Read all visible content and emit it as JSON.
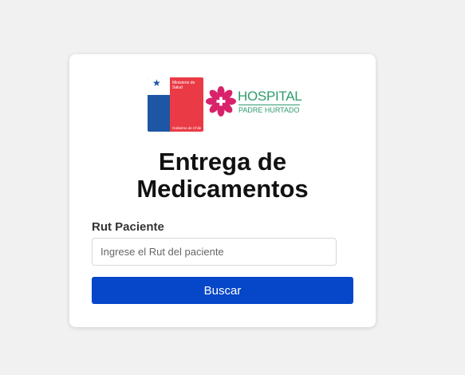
{
  "logos": {
    "ministry_line1": "Ministerio de",
    "ministry_line2": "Salud",
    "government": "Gobierno de Chile",
    "hospital_name": "HOSPITAL",
    "hospital_sub": "PADRE HURTADO"
  },
  "form": {
    "title_line1": "Entrega de",
    "title_line2": "Medicamentos",
    "rut_label": "Rut Paciente",
    "rut_placeholder": "Ingrese el Rut del paciente",
    "rut_value": "",
    "search_button": "Buscar"
  },
  "colors": {
    "button": "#0646c8",
    "hospital_green": "#2f9b6e",
    "hospital_magenta": "#d8236b",
    "ministry_blue": "#1d56a5",
    "ministry_red": "#ea3a45"
  },
  "icons": {
    "ministry": "ministry-of-health-logo",
    "hospital": "hospital-padre-hurtado-logo"
  }
}
